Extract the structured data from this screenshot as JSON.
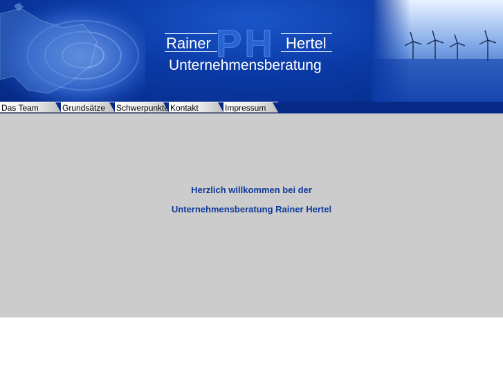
{
  "header": {
    "logo_first": "Rainer",
    "logo_last": "Hertel",
    "logo_monogram": "PH",
    "logo_subtitle": "Unternehmensberatung"
  },
  "nav": {
    "tabs": [
      {
        "label": "Das Team"
      },
      {
        "label": "Grundsätze"
      },
      {
        "label": "Schwerpunkte"
      },
      {
        "label": "Kontakt"
      },
      {
        "label": "Impressum"
      }
    ]
  },
  "main": {
    "welcome_line1": "Herzlich willkommen bei der",
    "welcome_line2": "Unternehmensberatung Rainer Hertel"
  },
  "colors": {
    "header_blue": "#0b3aa6",
    "content_gray": "#cccccc",
    "welcome_text": "#103a9a"
  },
  "icons": [
    "map-ripple-image",
    "wind-turbine-image"
  ]
}
